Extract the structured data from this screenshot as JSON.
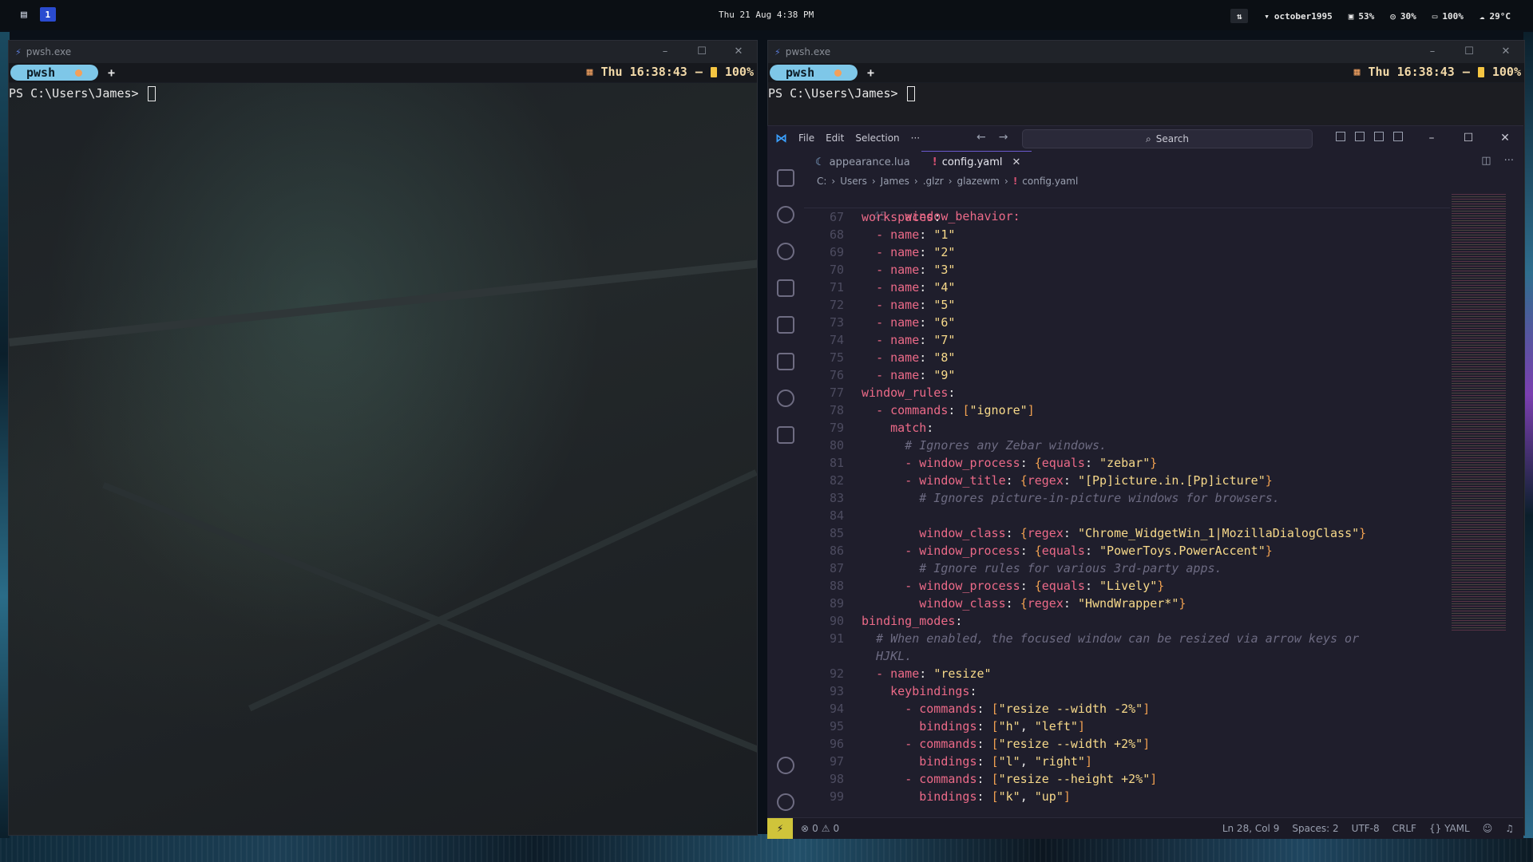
{
  "topbar": {
    "workspace": "1",
    "datetime": "Thu 21 Aug 4:38 PM",
    "wifi": "october1995",
    "cpu": "53%",
    "gpu": "30%",
    "battery": "100%",
    "temp": "29°C"
  },
  "terminal_left": {
    "window_title": "pwsh.exe",
    "tab_label": "pwsh",
    "new_tab": "+",
    "clock": "Thu 16:38:43",
    "dash": "—",
    "battery": "100%",
    "prompt": "PS C:\\Users\\James> "
  },
  "terminal_right": {
    "window_title": "pwsh.exe",
    "tab_label": "pwsh",
    "new_tab": "+",
    "clock": "Thu 16:38:43",
    "dash": "—",
    "battery": "100%",
    "prompt": "PS C:\\Users\\James> "
  },
  "vscode": {
    "menu": [
      "File",
      "Edit",
      "Selection",
      "···"
    ],
    "search": "Search",
    "tabs": [
      {
        "label": "appearance.lua",
        "icon": "lua-file-icon"
      },
      {
        "label": "config.yaml",
        "icon": "yaml-file-icon"
      }
    ],
    "breadcrumb": [
      "C:",
      "Users",
      "James",
      ".glzr",
      "glazewm",
      "config.yaml"
    ],
    "sticky": {
      "num": "45",
      "text": "window_behavior:"
    },
    "status": {
      "errors": "0",
      "warnings": "0",
      "position": "Ln 28, Col 9",
      "spaces": "Spaces: 2",
      "encoding": "UTF-8",
      "eol": "CRLF",
      "language": "YAML"
    }
  },
  "code_lines": [
    {
      "n": "67",
      "html": "<span class='k'>workspaces</span>:"
    },
    {
      "n": "68",
      "html": "  <span class='d'>-</span> <span class='k'>name</span>: <span class='s'>\"1\"</span>"
    },
    {
      "n": "69",
      "html": "  <span class='d'>-</span> <span class='k'>name</span>: <span class='s'>\"2\"</span>"
    },
    {
      "n": "70",
      "html": "  <span class='d'>-</span> <span class='k'>name</span>: <span class='s'>\"3\"</span>"
    },
    {
      "n": "71",
      "html": "  <span class='d'>-</span> <span class='k'>name</span>: <span class='s'>\"4\"</span>"
    },
    {
      "n": "72",
      "html": "  <span class='d'>-</span> <span class='k'>name</span>: <span class='s'>\"5\"</span>"
    },
    {
      "n": "73",
      "html": "  <span class='d'>-</span> <span class='k'>name</span>: <span class='s'>\"6\"</span>"
    },
    {
      "n": "74",
      "html": "  <span class='d'>-</span> <span class='k'>name</span>: <span class='s'>\"7\"</span>"
    },
    {
      "n": "75",
      "html": "  <span class='d'>-</span> <span class='k'>name</span>: <span class='s'>\"8\"</span>"
    },
    {
      "n": "76",
      "html": "  <span class='d'>-</span> <span class='k'>name</span>: <span class='s'>\"9\"</span>"
    },
    {
      "n": "77",
      "html": "<span class='k'>window_rules</span>:"
    },
    {
      "n": "78",
      "html": "  <span class='d'>-</span> <span class='k'>commands</span>: <span class='p'>[</span><span class='s'>\"ignore\"</span><span class='p'>]</span>"
    },
    {
      "n": "79",
      "html": "    <span class='k'>match</span>:"
    },
    {
      "n": "80",
      "html": "      <span class='c'># Ignores any Zebar windows.</span>"
    },
    {
      "n": "81",
      "html": "      <span class='d'>-</span> <span class='k'>window_process</span>: <span class='p'>{</span><span class='k'>equals</span>: <span class='s'>\"zebar\"</span><span class='p'>}</span>"
    },
    {
      "n": "82",
      "html": "      <span class='d'>-</span> <span class='k'>window_title</span>: <span class='p'>{</span><span class='k'>regex</span>: <span class='s'>\"[Pp]icture.in.[Pp]icture\"</span><span class='p'>}</span>"
    },
    {
      "n": "83",
      "html": "        <span class='c'># Ignores picture-in-picture windows for browsers.</span>"
    },
    {
      "n": "84",
      "html": ""
    },
    {
      "n": "85",
      "html": "        <span class='k'>window_class</span>: <span class='p'>{</span><span class='k'>regex</span>: <span class='s'>\"Chrome_WidgetWin_1|MozillaDialogClass\"</span><span class='p'>}</span>"
    },
    {
      "n": "86",
      "html": "      <span class='d'>-</span> <span class='k'>window_process</span>: <span class='p'>{</span><span class='k'>equals</span>: <span class='s'>\"PowerToys.PowerAccent\"</span><span class='p'>}</span>"
    },
    {
      "n": "87",
      "html": "        <span class='c'># Ignore rules for various 3rd-party apps.</span>"
    },
    {
      "n": "88",
      "html": "      <span class='d'>-</span> <span class='k'>window_process</span>: <span class='p'>{</span><span class='k'>equals</span>: <span class='s'>\"Lively\"</span><span class='p'>}</span>"
    },
    {
      "n": "89",
      "html": "        <span class='k'>window_class</span>: <span class='p'>{</span><span class='k'>regex</span>: <span class='s'>\"HwndWrapper*\"</span><span class='p'>}</span>"
    },
    {
      "n": "90",
      "html": "<span class='k'>binding_modes</span>:"
    },
    {
      "n": "91",
      "html": "  <span class='c'># When enabled, the focused window can be resized via arrow keys or</span>"
    },
    {
      "n": "",
      "html": "  <span class='c'>HJKL.</span>"
    },
    {
      "n": "92",
      "html": "  <span class='d'>-</span> <span class='k'>name</span>: <span class='s'>\"resize\"</span>"
    },
    {
      "n": "93",
      "html": "    <span class='k'>keybindings</span>:"
    },
    {
      "n": "94",
      "html": "      <span class='d'>-</span> <span class='k'>commands</span>: <span class='p'>[</span><span class='s'>\"resize --width -2%\"</span><span class='p'>]</span>"
    },
    {
      "n": "95",
      "html": "        <span class='k'>bindings</span>: <span class='p'>[</span><span class='s'>\"h\"</span>, <span class='s'>\"left\"</span><span class='p'>]</span>"
    },
    {
      "n": "96",
      "html": "      <span class='d'>-</span> <span class='k'>commands</span>: <span class='p'>[</span><span class='s'>\"resize --width +2%\"</span><span class='p'>]</span>"
    },
    {
      "n": "97",
      "html": "        <span class='k'>bindings</span>: <span class='p'>[</span><span class='s'>\"l\"</span>, <span class='s'>\"right\"</span><span class='p'>]</span>"
    },
    {
      "n": "98",
      "html": "      <span class='d'>-</span> <span class='k'>commands</span>: <span class='p'>[</span><span class='s'>\"resize --height +2%\"</span><span class='p'>]</span>"
    },
    {
      "n": "99",
      "html": "        <span class='k'>bindings</span>: <span class='p'>[</span><span class='s'>\"k\"</span>, <span class='s'>\"up\"</span><span class='p'>]</span>"
    }
  ]
}
